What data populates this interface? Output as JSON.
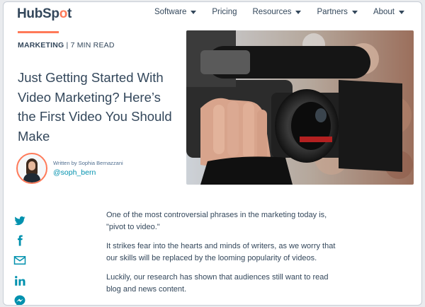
{
  "brand": {
    "name_a": "HubSp",
    "name_b": "o",
    "name_c": "t"
  },
  "nav": [
    {
      "label": "Software",
      "has_menu": true
    },
    {
      "label": "Pricing",
      "has_menu": false
    },
    {
      "label": "Resources",
      "has_menu": true
    },
    {
      "label": "Partners",
      "has_menu": true
    },
    {
      "label": "About",
      "has_menu": true
    }
  ],
  "article": {
    "category": "MARKETING",
    "separator": " | ",
    "read_time": "7 MIN READ",
    "title": "Just Getting Started With Video Marketing? Here’s the First Video You Should Make",
    "author_line": "Written by Sophia Bernazzani",
    "author_handle": "@soph_bern",
    "paragraphs": [
      "One of the most controversial phrases in the marketing today is, \"pivot to video.\"",
      "It strikes fear into the hearts and minds of writers, as we worry that our skills will be replaced by the looming popularity of videos.",
      "Luckily, our research has shown that audiences still want to read blog and news content."
    ]
  },
  "social": [
    "twitter-icon",
    "facebook-icon",
    "email-icon",
    "linkedin-icon",
    "messenger-icon"
  ],
  "colors": {
    "accent": "#ff7a59",
    "text": "#33475b",
    "link": "#0091ae",
    "social": "#0091ae"
  }
}
